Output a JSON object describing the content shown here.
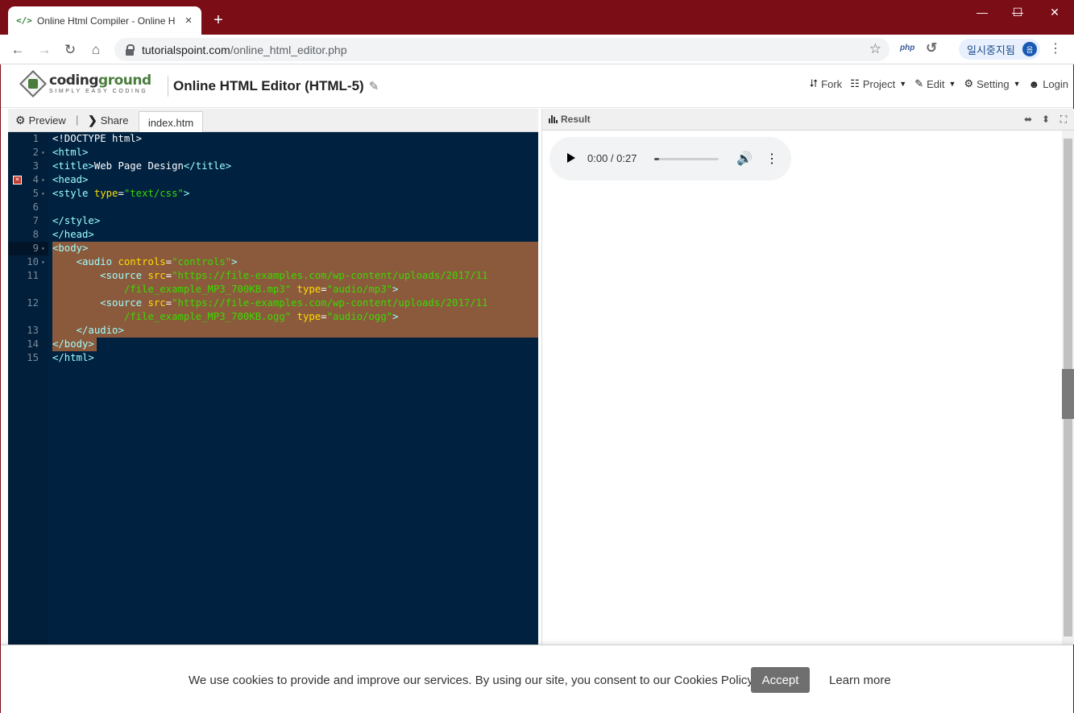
{
  "browser": {
    "tab_title": "Online Html Compiler - Online H",
    "favicon": "</>",
    "tab_close": "×",
    "new_tab": "+",
    "window_controls": {
      "minimize": "—",
      "maximize": "☐",
      "close": "✕"
    },
    "url_host": "tutorialspoint.com",
    "url_path": "/online_html_editor.php",
    "extension_php": "php",
    "profile_label": "일시중지됨",
    "profile_avatar": "음"
  },
  "site": {
    "logo_name_a": "coding",
    "logo_name_b": "ground",
    "logo_tagline": "SIMPLY EASY CODING",
    "page_title": "Online HTML Editor (HTML-5)",
    "nav": [
      {
        "label": "Fork",
        "icon": "fork-icon",
        "caret": false
      },
      {
        "label": "Project",
        "icon": "sitemap-icon",
        "caret": true
      },
      {
        "label": "Edit",
        "icon": "edit-icon",
        "caret": true
      },
      {
        "label": "Setting",
        "icon": "gear-icon",
        "caret": true
      },
      {
        "label": "Login",
        "icon": "user-icon",
        "caret": false
      }
    ]
  },
  "editor": {
    "preview_label": "Preview",
    "separator": "|",
    "share_label": "Share",
    "file_tab": "index.htm",
    "line_numbers": [
      "1",
      "2",
      "3",
      "4",
      "5",
      "6",
      "7",
      "8",
      "9",
      "10",
      "11",
      "",
      "12",
      "",
      "13",
      "14",
      "15"
    ]
  },
  "result": {
    "title": "Result",
    "audio_time": "0:00 / 0:27",
    "audio_progress": 0.07
  },
  "cookie": {
    "message": "We use cookies to provide and improve our services. By using our site, you consent to our Cookies Policy.",
    "accept_label": "Accept",
    "learn_more_label": "Learn more"
  },
  "colors": {
    "chrome_frame": "#7b0d17",
    "editor_bg": "#002240",
    "selection": "#8b5a3c",
    "tag": "#9effff",
    "attr": "#ffdd00",
    "string": "#3ad900"
  }
}
